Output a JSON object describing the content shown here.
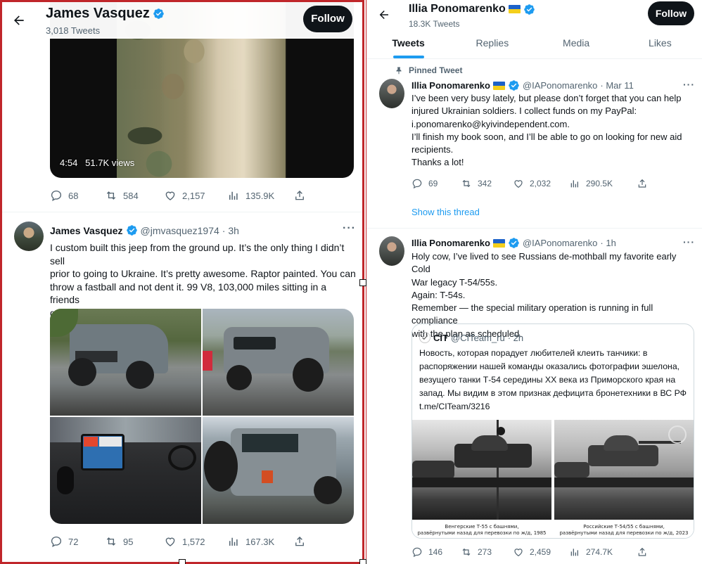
{
  "colors": {
    "accent": "#1d9bf0",
    "text": "#0f1419",
    "muted": "#536471",
    "follow_bg": "#0f1419",
    "frame_red": "#c0262a"
  },
  "left": {
    "header": {
      "name": "James Vasquez",
      "tweet_count": "3,018 Tweets",
      "follow_label": "Follow",
      "back_icon": "arrow-left-icon"
    },
    "video": {
      "duration": "4:54",
      "views": "51.7K views"
    },
    "video_stats": {
      "replies": "68",
      "retweets": "584",
      "likes": "2,157",
      "views": "135.9K"
    },
    "tweet": {
      "name": "James Vasquez",
      "handle": "@jmvasquez1974",
      "time": "· 3h",
      "more": "···",
      "text": "I custom built this jeep from the ground up. It’s the only thing I didn’t sell\nprior to going to Ukraine. It’s pretty awesome. Raptor painted. You can\nthrow a fastball and not dent it. 99 V8, 103,000 miles sitting in a friends\ngarage. Make me an offer.",
      "stats": {
        "replies": "72",
        "retweets": "95",
        "likes": "1,572",
        "views": "167.3K"
      }
    }
  },
  "right": {
    "header": {
      "name": "Illia Ponomarenko",
      "tweet_count": "18.3K Tweets",
      "follow_label": "Follow",
      "back_icon": "arrow-left-icon"
    },
    "tabs": [
      {
        "label": "Tweets",
        "active": true
      },
      {
        "label": "Replies",
        "active": false
      },
      {
        "label": "Media",
        "active": false
      },
      {
        "label": "Likes",
        "active": false
      }
    ],
    "pinned_tweet": {
      "pinned_label": "Pinned Tweet",
      "name": "Illia Ponomarenko",
      "handle": "@IAPonomarenko",
      "time": "· Mar 11",
      "more": "···",
      "text": "I’ve been very busy lately, but please don’t forget that you can help\ninjured Ukrainian soldiers. I collect funds on my PayPal:\ni.ponomarenko@kyivindependent.com.\nI’ll finish my book soon, and I’ll be able to go on looking for new aid\nrecipients.\nThanks a lot!",
      "stats": {
        "replies": "69",
        "retweets": "342",
        "likes": "2,032",
        "views": "290.5K"
      },
      "show_thread": "Show this thread"
    },
    "tweet2": {
      "name": "Illia Ponomarenko",
      "handle": "@IAPonomarenko",
      "time": "· 1h",
      "more": "···",
      "text": "Holy cow, I’ve lived to see Russians de-mothball my favorite early Cold\nWar legacy T-54/55s.\nAgain: T-54s.\nRemember — the special military operation is running in full compliance\nwith the plan as scheduled.",
      "quote": {
        "name": "CIT",
        "handle": "@CITeam_ru",
        "time": "· 2h",
        "text": "Новость, которая порадует любителей клеить танчики: в\nраспоряжении нашей команды оказались фотографии эшелона,\nвезущего танки Т-54 середины XX века из Приморского края на\nзапад. Мы видим в этом признак дефицита бронетехники в ВС РФ\nt.me/CITeam/3216",
        "caption_left": "Венгерские Т-55 с башнями,\nразвёрнутыми назад для перевозки по ж/д, 1985",
        "caption_right": "Российские Т-54/55 с башнями,\nразвёрнутыми назад для перевозки по ж/д, 2023"
      },
      "stats": {
        "replies": "146",
        "retweets": "273",
        "likes": "2,459",
        "views": "274.7K"
      }
    }
  }
}
